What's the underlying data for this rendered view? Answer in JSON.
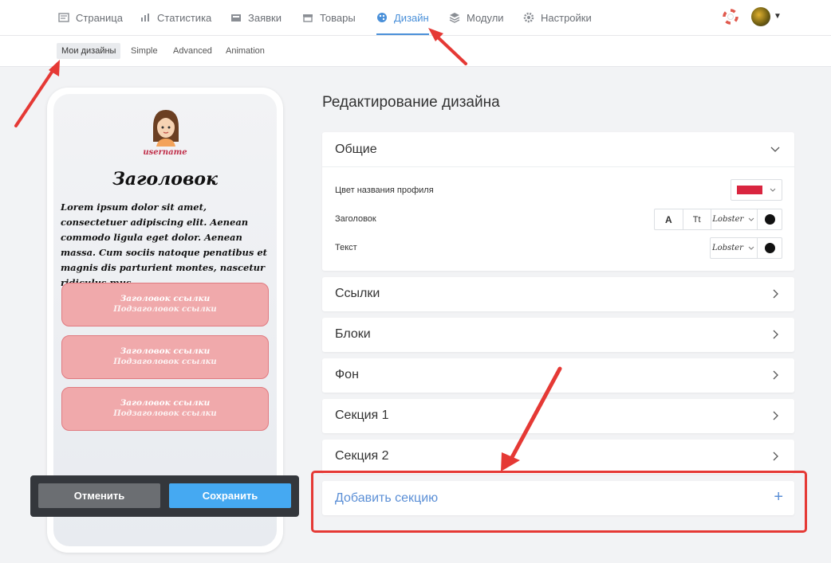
{
  "topnav": {
    "items": [
      {
        "label": "Страница",
        "icon": "page-icon"
      },
      {
        "label": "Статистика",
        "icon": "chart-icon"
      },
      {
        "label": "Заявки",
        "icon": "inbox-icon"
      },
      {
        "label": "Товары",
        "icon": "store-icon"
      },
      {
        "label": "Дизайн",
        "icon": "palette-icon",
        "active": true
      },
      {
        "label": "Модули",
        "icon": "layers-icon"
      },
      {
        "label": "Настройки",
        "icon": "gear-icon"
      }
    ],
    "active_color": "#4a90d9"
  },
  "subnav": {
    "items": [
      {
        "label": "Мои дизайны",
        "active": true
      },
      {
        "label": "Simple"
      },
      {
        "label": "Advanced"
      },
      {
        "label": "Animation"
      }
    ]
  },
  "preview": {
    "username": "username",
    "title": "Заголовок",
    "text": "Lorem ipsum dolor sit amet, consectetuer adipiscing elit. Aenean commodo ligula eget dolor. Aenean massa. Cum sociis natoque penatibus et magnis dis parturient montes, nascetur ridiculus mus.",
    "links": [
      {
        "title": "Заголовок ссылки",
        "subtitle": "Подзаголовок ссылки"
      },
      {
        "title": "Заголовок ссылки",
        "subtitle": "Подзаголовок ссылки"
      },
      {
        "title": "Заголовок ссылки",
        "subtitle": "Подзаголовок ссылки"
      }
    ],
    "link_color": "#f0a9ab"
  },
  "actions": {
    "cancel": "Отменить",
    "save": "Сохранить"
  },
  "editor": {
    "title": "Редактирование дизайна",
    "general": {
      "label": "Общие",
      "rows": {
        "profile_color_label": "Цвет названия профиля",
        "profile_color": "#d9253f",
        "heading_label": "Заголовок",
        "heading_btn_a": "A",
        "heading_btn_tt": "Tt",
        "heading_font": "Lobster",
        "text_label": "Текст",
        "text_font": "Lobster"
      }
    },
    "sections": [
      "Ссылки",
      "Блоки",
      "Фон",
      "Секция 1",
      "Секция 2"
    ],
    "add_section": "Добавить секцию",
    "add_icon": "+"
  }
}
